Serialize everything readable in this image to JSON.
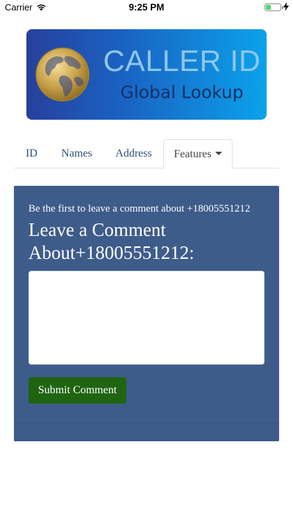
{
  "status_bar": {
    "carrier": "Carrier",
    "time": "9:25 PM",
    "battery_level": 0.35,
    "wifi_icon": "wifi-icon",
    "battery_icon": "battery-icon",
    "charging_icon": "charging-bolt-icon"
  },
  "banner": {
    "title": "CALLER ID",
    "subtitle": "Global Lookup",
    "logo_icon": "globe-icon",
    "colors": {
      "gradient_start": "#27409b",
      "gradient_end": "#0ba2ea",
      "title": "#8fc6ec",
      "subtitle": "#173066",
      "globe_gold": "#c9a24a"
    }
  },
  "tabs": [
    {
      "label": "ID",
      "active": false
    },
    {
      "label": "Names",
      "active": false
    },
    {
      "label": "Address",
      "active": false
    },
    {
      "label": "Features",
      "active": true,
      "dropdown": true
    }
  ],
  "comment_section": {
    "note": "Be the first to leave a comment about +18005551212",
    "heading": "Leave a Comment About+18005551212:",
    "textarea_value": "",
    "submit_label": "Submit Comment",
    "colors": {
      "panel_bg": "#3e5c8a",
      "submit_bg": "#1f6511",
      "tab_link": "#305079"
    }
  }
}
